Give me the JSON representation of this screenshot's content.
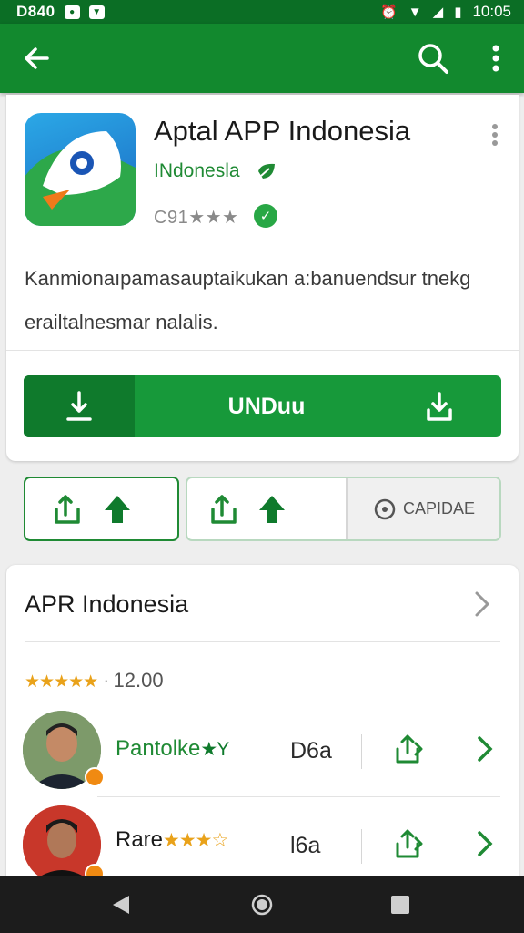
{
  "status_bar": {
    "time_left": "D840",
    "time_right": "10:05"
  },
  "app": {
    "title": "Aptal APP Indonesia",
    "developer": "INdonesla",
    "rating_text": "C91★★★",
    "description": "Kanmionaıpamasauptaikukan a:banuendsur tnekg erailtalnesmar nalalis.",
    "install_label": "UNDuu"
  },
  "actions": {
    "capture_label": "CAPIDAE"
  },
  "reviews_section": {
    "title": "APR Indonesia",
    "overall_stars": "★★★★★",
    "overall_value": "12.00",
    "items": [
      {
        "name": "Pantolke",
        "stars": "★Y",
        "count": "D6a"
      },
      {
        "name": "Rare",
        "stars": "★★★☆",
        "count": "l6a"
      }
    ]
  },
  "colors": {
    "primary": "#12892e",
    "primary_dark": "#0b6e25",
    "accent": "#17993a",
    "star": "#e9a21a"
  },
  "icons": [
    "back-arrow-icon",
    "search-icon",
    "more-vert-icon",
    "download-icon",
    "share-icon",
    "upload-arrow-icon",
    "camera-icon",
    "chevron-right-icon"
  ]
}
